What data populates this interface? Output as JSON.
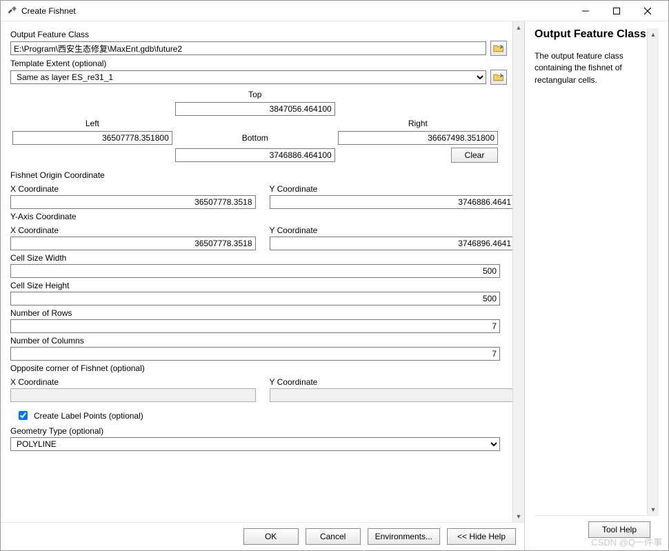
{
  "window": {
    "title": "Create Fishnet"
  },
  "labels": {
    "outputFC": "Output Feature Class",
    "templateExtent": "Template Extent (optional)",
    "top": "Top",
    "bottom": "Bottom",
    "left": "Left",
    "right": "Right",
    "clear": "Clear",
    "fishnetOrigin": "Fishnet Origin Coordinate",
    "xcoord": "X Coordinate",
    "ycoord": "Y Coordinate",
    "yaxisCoord": "Y-Axis Coordinate",
    "cellW": "Cell Size Width",
    "cellH": "Cell Size Height",
    "numRows": "Number of Rows",
    "numCols": "Number of Columns",
    "oppCorner": "Opposite corner of Fishnet (optional)",
    "createLabels": "Create Label Points (optional)",
    "geomType": "Geometry Type (optional)"
  },
  "values": {
    "outputFC": "E:\\Program\\西安生态修复\\MaxEnt.gdb\\future2",
    "templateExtent": "Same as layer ES_re31_1",
    "top": "3847056.464100",
    "bottom": "3746886.464100",
    "left": "36507778.351800",
    "right": "36667498.351800",
    "origin_x": "36507778.3518",
    "origin_y": "3746886.4641",
    "yaxis_x": "36507778.3518",
    "yaxis_y": "3746896.4641",
    "cellW": "500",
    "cellH": "500",
    "numRows": "7",
    "numCols": "7",
    "opp_x": "",
    "opp_y": "",
    "createLabels": true,
    "geomType": "POLYLINE"
  },
  "buttons": {
    "ok": "OK",
    "cancel": "Cancel",
    "env": "Environments...",
    "hideHelp": "<< Hide Help",
    "toolHelp": "Tool Help"
  },
  "help": {
    "title": "Output Feature Class",
    "body": "The output feature class containing the fishnet of rectangular cells."
  },
  "watermark": "CSDN @Q一件事"
}
